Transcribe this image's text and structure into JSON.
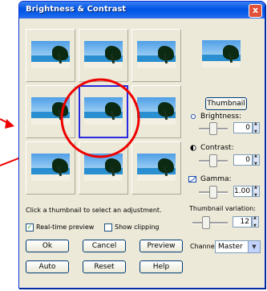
{
  "window": {
    "title": "Brightness & Contrast",
    "close_symbol": "x"
  },
  "thumbnails": {
    "selected_index": 4,
    "count": 9
  },
  "buttons": {
    "thumbnail": "Thumbnail",
    "ok": "Ok",
    "cancel": "Cancel",
    "preview": "Preview",
    "auto": "Auto",
    "reset": "Reset",
    "help": "Help"
  },
  "adjustments": {
    "brightness": {
      "label": "Brightness:",
      "value": "0"
    },
    "contrast": {
      "label": "Contrast:",
      "value": "0"
    },
    "gamma": {
      "label": "Gamma:",
      "value": "1.00"
    }
  },
  "thumbnail_variation": {
    "label": "Thumbnail variation:",
    "value": "12"
  },
  "instruction": "Click a thumbnail to select an adjustment.",
  "options": {
    "realtime_preview": {
      "label": "Real-time preview",
      "checked": true
    },
    "show_clipping": {
      "label": "Show clipping",
      "checked": false
    }
  },
  "channel": {
    "label": "Channel:",
    "value": "Master"
  },
  "annotations": {
    "highlight_color": "#ff0000"
  }
}
